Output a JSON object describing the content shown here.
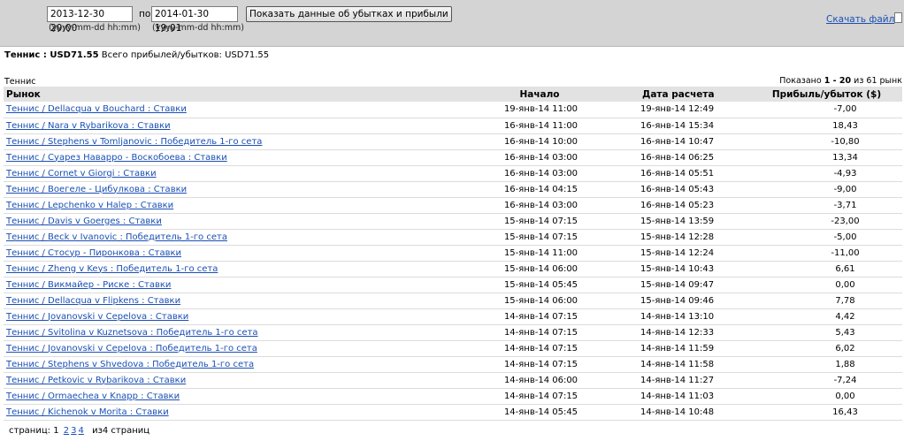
{
  "filter": {
    "date_from": "2013-12-30 20:00",
    "separator": "по",
    "date_to": "2014-01-30 19:01",
    "hint_from": "(yyyy-mm-dd hh:mm)",
    "hint_to": "(yyyy-mm-dd hh:mm)",
    "show_button": "Показать данные об убытках и прибыли",
    "download_link": "Скачать файл"
  },
  "summary": {
    "sport_total": "Теннис : USD71.55",
    "all_label": "Всего прибылей/убытков:",
    "all_value": "USD71.55"
  },
  "section": {
    "title": "Теннис",
    "shown_prefix": "Показано",
    "shown_range": "1 - 20",
    "shown_suffix": "из 61 рынк"
  },
  "table": {
    "headers": [
      "Рынок",
      "Начало",
      "Дата расчета",
      "Прибыль/убыток ($)"
    ],
    "rows": [
      {
        "market": "Теннис / Dellacqua v Bouchard : Ставки",
        "start": "19-янв-14 11:00",
        "settle": "19-янв-14 12:49",
        "profit": "-7,00"
      },
      {
        "market": "Теннис / Nara v Rybarikova : Ставки",
        "start": "16-янв-14 11:00",
        "settle": "16-янв-14 15:34",
        "profit": "18,43"
      },
      {
        "market": "Теннис / Stephens v Tomljanovic : Победитель 1-го сета",
        "start": "16-янв-14 10:00",
        "settle": "16-янв-14 10:47",
        "profit": "-10,80"
      },
      {
        "market": "Теннис / Суарез Наварро - Воскобоева : Ставки",
        "start": "16-янв-14 03:00",
        "settle": "16-янв-14 06:25",
        "profit": "13,34"
      },
      {
        "market": "Теннис / Cornet v Giorgi : Ставки",
        "start": "16-янв-14 03:00",
        "settle": "16-янв-14 05:51",
        "profit": "-4,93"
      },
      {
        "market": "Теннис / Воегеле - Цибулкова : Ставки",
        "start": "16-янв-14 04:15",
        "settle": "16-янв-14 05:43",
        "profit": "-9,00"
      },
      {
        "market": "Теннис / Lepchenko v Halep : Ставки",
        "start": "16-янв-14 03:00",
        "settle": "16-янв-14 05:23",
        "profit": "-3,71"
      },
      {
        "market": "Теннис / Davis v Goerges : Ставки",
        "start": "15-янв-14 07:15",
        "settle": "15-янв-14 13:59",
        "profit": "-23,00"
      },
      {
        "market": "Теннис / Beck v Ivanovic : Победитель 1-го сета",
        "start": "15-янв-14 07:15",
        "settle": "15-янв-14 12:28",
        "profit": "-5,00"
      },
      {
        "market": "Теннис / Стосур - Пиронкова : Ставки",
        "start": "15-янв-14 11:00",
        "settle": "15-янв-14 12:24",
        "profit": "-11,00"
      },
      {
        "market": "Теннис / Zheng v Keys : Победитель 1-го сета",
        "start": "15-янв-14 06:00",
        "settle": "15-янв-14 10:43",
        "profit": "6,61"
      },
      {
        "market": "Теннис / Викмайер - Риске : Ставки",
        "start": "15-янв-14 05:45",
        "settle": "15-янв-14 09:47",
        "profit": "0,00"
      },
      {
        "market": "Теннис / Dellacqua v Flipkens : Ставки",
        "start": "15-янв-14 06:00",
        "settle": "15-янв-14 09:46",
        "profit": "7,78"
      },
      {
        "market": "Теннис / Jovanovski v Cepelova : Ставки",
        "start": "14-янв-14 07:15",
        "settle": "14-янв-14 13:10",
        "profit": "4,42"
      },
      {
        "market": "Теннис / Svitolina v Kuznetsova : Победитель 1-го сета",
        "start": "14-янв-14 07:15",
        "settle": "14-янв-14 12:33",
        "profit": "5,43"
      },
      {
        "market": "Теннис / Jovanovski v Cepelova : Победитель 1-го сета",
        "start": "14-янв-14 07:15",
        "settle": "14-янв-14 11:59",
        "profit": "6,02"
      },
      {
        "market": "Теннис / Stephens v Shvedova : Победитель 1-го сета",
        "start": "14-янв-14 07:15",
        "settle": "14-янв-14 11:58",
        "profit": "1,88"
      },
      {
        "market": "Теннис / Petkovic v Rybarikova : Ставки",
        "start": "14-янв-14 06:00",
        "settle": "14-янв-14 11:27",
        "profit": "-7,24"
      },
      {
        "market": "Теннис / Ormaechea v Knapp : Ставки",
        "start": "14-янв-14 07:15",
        "settle": "14-янв-14 11:03",
        "profit": "0,00"
      },
      {
        "market": "Теннис / Kichenok v Morita : Ставки",
        "start": "14-янв-14 05:45",
        "settle": "14-янв-14 10:48",
        "profit": "16,43"
      }
    ]
  },
  "pager": {
    "label": "страниц:",
    "current": "1",
    "pages": [
      "2",
      "3",
      "4"
    ],
    "total": "из4 страниц"
  }
}
